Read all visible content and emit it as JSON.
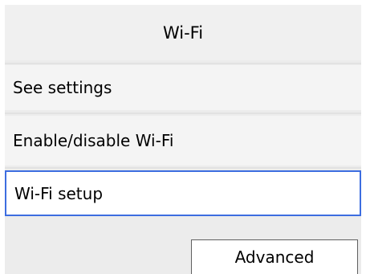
{
  "header": {
    "title": "Wi-Fi"
  },
  "menu": {
    "items": [
      {
        "label": "See settings"
      },
      {
        "label": "Enable/disable Wi-Fi"
      },
      {
        "label": "Wi-Fi setup",
        "selected": true
      }
    ]
  },
  "footer": {
    "advanced_label": "Advanced"
  },
  "colors": {
    "background": "#ececec",
    "selection_border": "#3d6de0",
    "button_border": "#606060"
  }
}
